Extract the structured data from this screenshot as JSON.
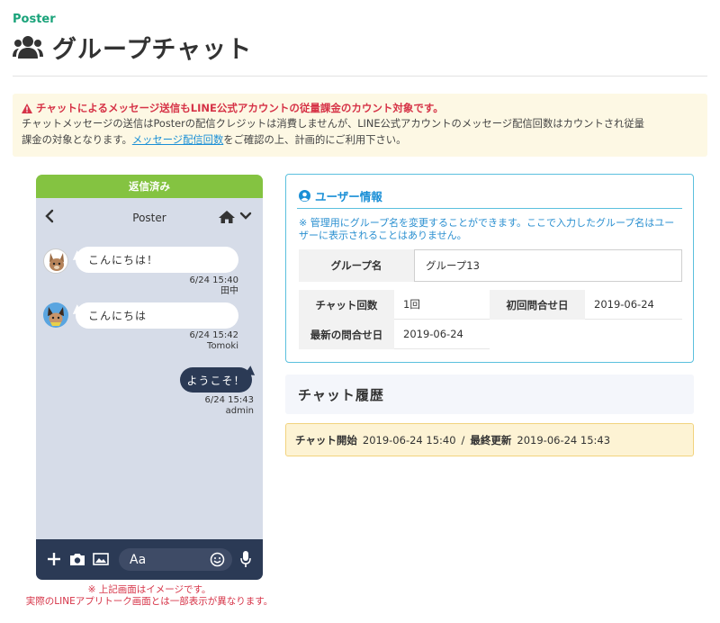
{
  "brand": "Poster",
  "page_title": "グループチャット",
  "alert": {
    "title": "チャットによるメッセージ送信もLINE公式アカウントの従量課金のカウント対象です。",
    "line1": "チャットメッセージの送信はPosterの配信クレジットは消費しませんが、LINE公式アカウントのメッセージ配信回数はカウントされ従量",
    "line2_pre": "課金の対象となります。",
    "link": "メッセージ配信回数",
    "line2_post": "をご確認の上、計画的にご利用下さい。"
  },
  "phone": {
    "status": "返信済み",
    "title": "Poster",
    "messages": [
      {
        "text": "こんにちは！",
        "time": "6/24 15:40",
        "user": "田中"
      },
      {
        "text": "こんにちは",
        "time": "6/24 15:42",
        "user": "Tomoki"
      },
      {
        "text": "ようこそ！",
        "time": "6/24 15:43",
        "user": "admin"
      }
    ],
    "input_placeholder": "Aa",
    "note_line1": "※ 上記画面はイメージです。",
    "note_line2": "実際のLINEアプリトーク画面とは一部表示が異なります。"
  },
  "user_info": {
    "title": "ユーザー情報",
    "note": "※ 管理用にグループ名を変更することができます。ここで入力したグループ名はユーザーに表示されることはありません。",
    "group_name_label": "グループ名",
    "group_name_value": "グループ13",
    "chat_count_label": "チャット回数",
    "chat_count_value": "1回",
    "first_contact_label": "初回問合せ日",
    "first_contact_value": "2019-06-24",
    "last_contact_label": "最新の問合せ日",
    "last_contact_value": "2019-06-24"
  },
  "history": {
    "title": "チャット履歴",
    "start_label": "チャット開始",
    "start_value": "2019-06-24 15:40",
    "separator": "/",
    "updated_label": "最終更新",
    "updated_value": "2019-06-24 15:43"
  }
}
